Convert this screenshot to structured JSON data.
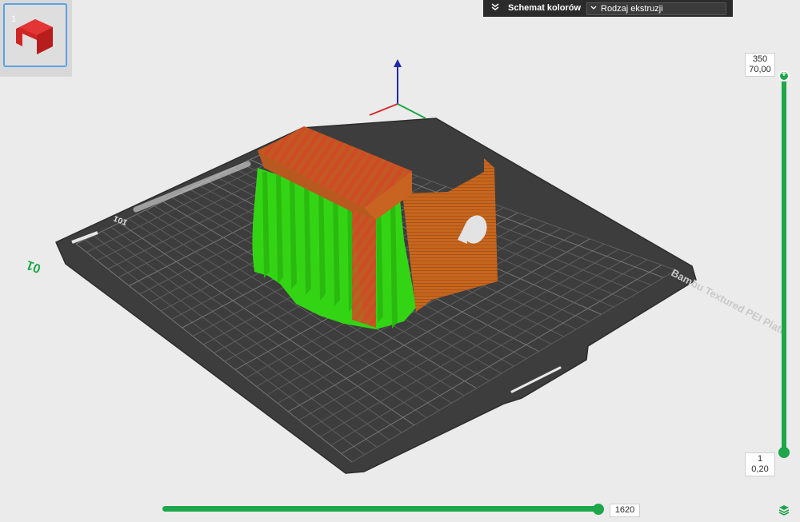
{
  "plate": {
    "thumbnail_number": "1",
    "logo_text": "Bambu Textured PEI Plate",
    "plate_number": "01"
  },
  "color_scheme": {
    "title": "Schemat kolorów",
    "selected": "Rodzaj ekstruzji"
  },
  "layer_slider": {
    "top_layer": "350",
    "top_height": "70,00",
    "bottom_layer": "1",
    "bottom_height": "0,20"
  },
  "move_slider": {
    "value": "1620"
  },
  "colors": {
    "support": "#33d414",
    "wall": "#c26a1c",
    "infill": "#c84b23",
    "accent": "#1ea64a",
    "bed": "#3d3d3d"
  },
  "icons": [
    "model-thumbnail-icon",
    "chevrons-down-icon",
    "chevron-down-icon",
    "plus-icon",
    "layers-icon"
  ]
}
